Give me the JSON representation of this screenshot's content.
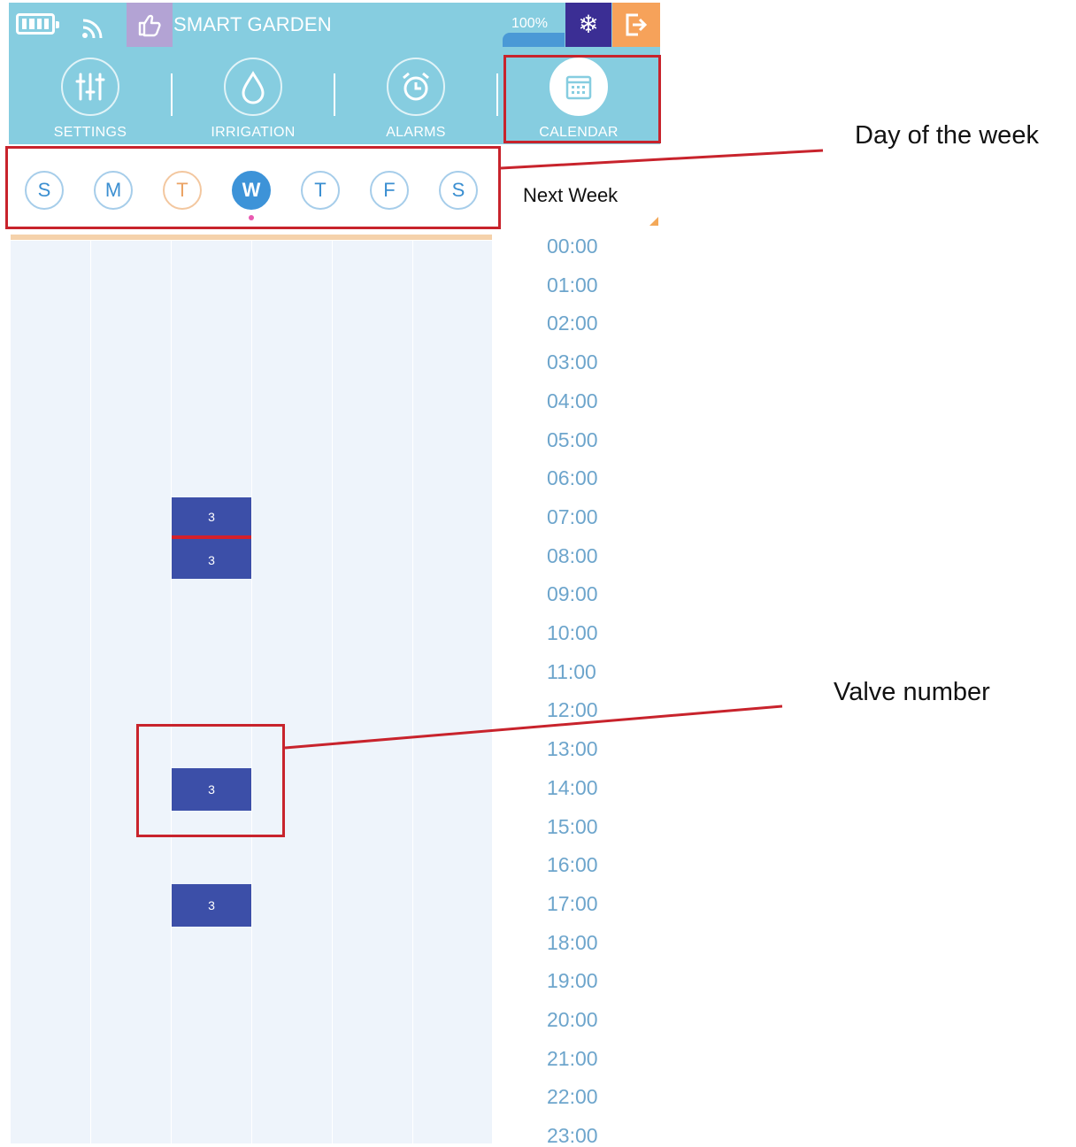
{
  "header": {
    "title": "SMART GARDEN",
    "level": "100%",
    "brand_color": "#86cde0",
    "icons": [
      "battery-icon",
      "wifi-icon",
      "thumbs-up-icon",
      "snowflake-icon",
      "logout-icon"
    ]
  },
  "nav": [
    {
      "label": "SETTINGS",
      "icon": "sliders-icon"
    },
    {
      "label": "IRRIGATION",
      "icon": "drop-icon"
    },
    {
      "label": "ALARMS",
      "icon": "alarm-clock-icon"
    },
    {
      "label": "CALENDAR",
      "icon": "calendar-icon",
      "active": true
    }
  ],
  "days": [
    {
      "letter": "S",
      "state": "normal"
    },
    {
      "letter": "M",
      "state": "normal"
    },
    {
      "letter": "T",
      "state": "today"
    },
    {
      "letter": "W",
      "state": "selected"
    },
    {
      "letter": "T",
      "state": "normal"
    },
    {
      "letter": "F",
      "state": "normal"
    },
    {
      "letter": "S",
      "state": "normal"
    }
  ],
  "next_week_label": "Next Week",
  "times": [
    "00:00",
    "01:00",
    "02:00",
    "03:00",
    "04:00",
    "05:00",
    "06:00",
    "07:00",
    "08:00",
    "09:00",
    "10:00",
    "11:00",
    "12:00",
    "13:00",
    "14:00",
    "15:00",
    "16:00",
    "17:00",
    "18:00",
    "19:00",
    "20:00",
    "21:00",
    "22:00",
    "23:00"
  ],
  "events": [
    {
      "valve": "3"
    },
    {
      "valve": "3"
    },
    {
      "valve": "3"
    },
    {
      "valve": "3"
    }
  ],
  "annotations": {
    "day_of_week": "Day of the week",
    "valve_number": "Valve number",
    "color": "#c8232c"
  }
}
